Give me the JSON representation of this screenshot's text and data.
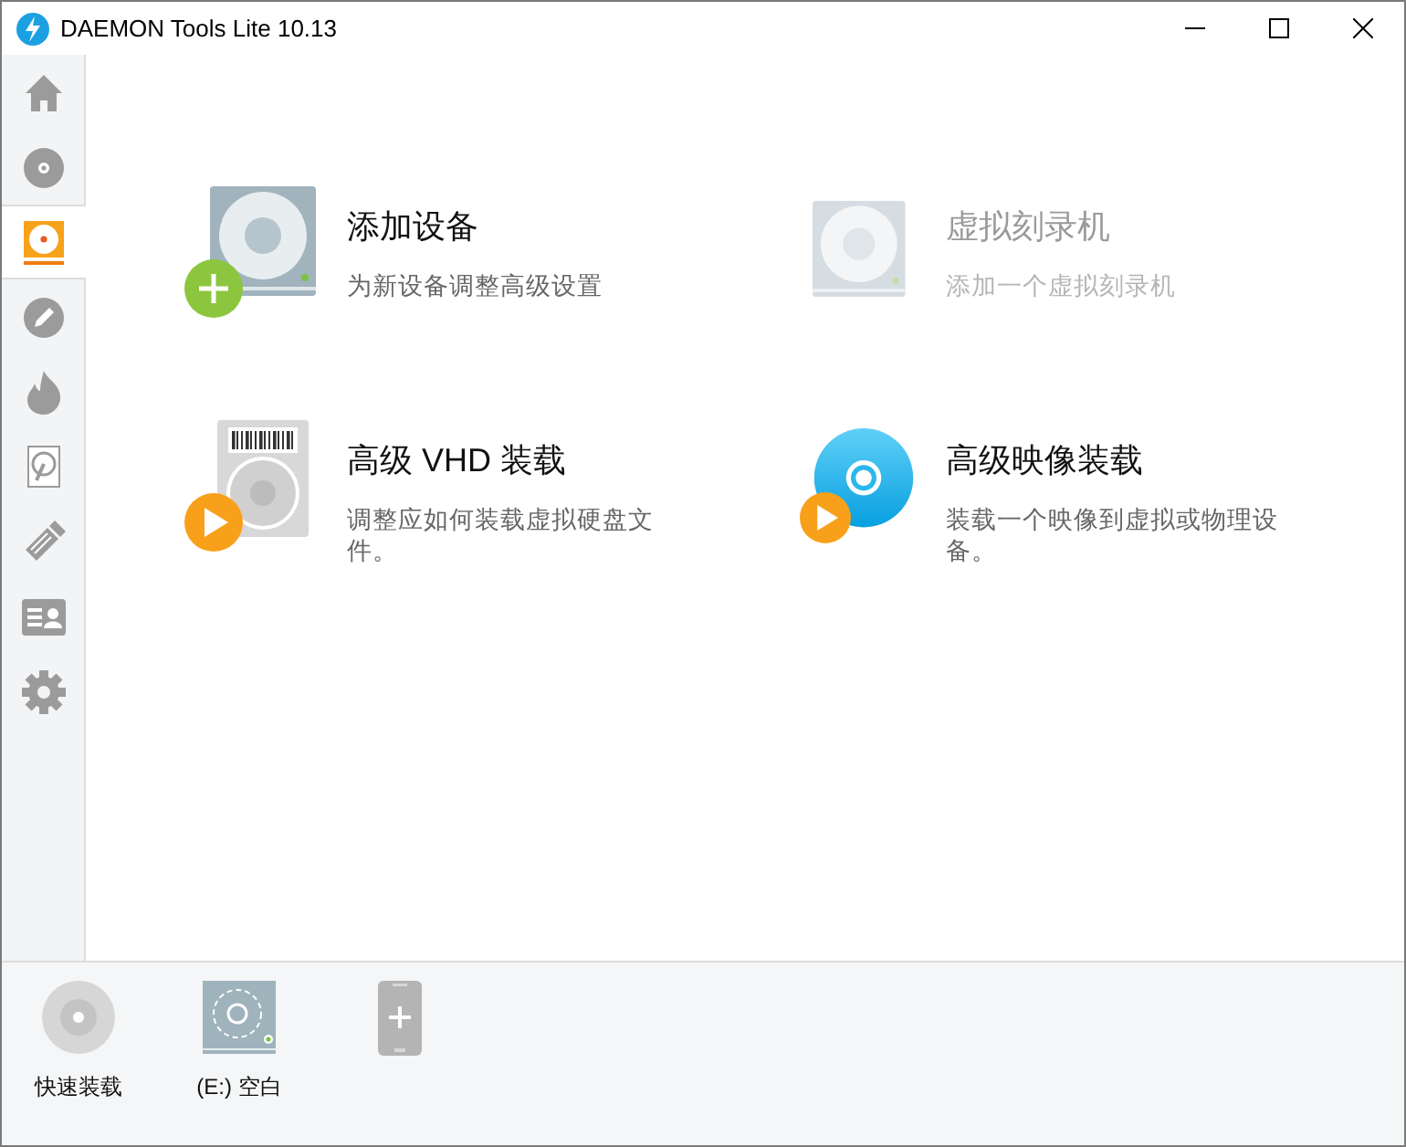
{
  "window": {
    "title": "DAEMON Tools Lite 10.13"
  },
  "sidebar": {
    "items": [
      {
        "kind": "home",
        "selected": false
      },
      {
        "kind": "disc",
        "selected": false
      },
      {
        "kind": "image-disc",
        "selected": true
      },
      {
        "kind": "pencil",
        "selected": false
      },
      {
        "kind": "fire",
        "selected": false
      },
      {
        "kind": "hdd",
        "selected": false
      },
      {
        "kind": "usb",
        "selected": false
      },
      {
        "kind": "contact",
        "selected": false
      },
      {
        "kind": "gear",
        "selected": false
      }
    ]
  },
  "actions": [
    {
      "kind": "add-device",
      "title": "添加设备",
      "description": "为新设备调整高级设置",
      "disabled": false
    },
    {
      "kind": "burner",
      "title": "虚拟刻录机",
      "description": "添加一个虚拟刻录机",
      "disabled": true
    },
    {
      "kind": "vhd",
      "title": "高级 VHD 装载",
      "description": "调整应如何装载虚拟硬盘文件。",
      "disabled": false
    },
    {
      "kind": "image",
      "title": "高级映像装载",
      "description": "装载一个映像到虚拟或物理设备。",
      "disabled": false
    }
  ],
  "devices": [
    {
      "kind": "quick-mount",
      "label": "快速装载"
    },
    {
      "kind": "drive",
      "label": "(E:) 空白"
    },
    {
      "kind": "add-phone"
    }
  ]
}
